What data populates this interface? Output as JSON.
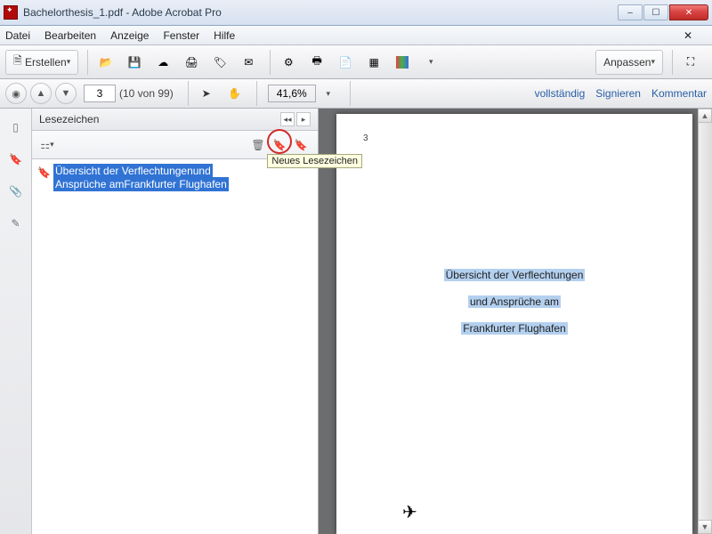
{
  "window": {
    "title": "Bachelorthesis_1.pdf - Adobe Acrobat Pro"
  },
  "menu": {
    "items": [
      "Datei",
      "Bearbeiten",
      "Anzeige",
      "Fenster",
      "Hilfe"
    ]
  },
  "toolbar": {
    "create": "Erstellen",
    "customize": "Anpassen"
  },
  "nav": {
    "page_value": "3",
    "page_of": "(10 von 99)",
    "zoom": "41,6%",
    "full": "vollständig",
    "sign": "Signieren",
    "comment": "Kommentar"
  },
  "bookmarks": {
    "title": "Lesezeichen",
    "tooltip": "Neues Lesezeichen",
    "item_line1": "Übersicht der Verflechtungenund",
    "item_line2": "Ansprüche amFrankfurter Flughafen"
  },
  "document": {
    "page_num": "3",
    "title_l1": "Übersicht der Verflechtungen",
    "title_l2": "und Ansprüche am",
    "title_l3": "Frankfurter Flughafen"
  }
}
